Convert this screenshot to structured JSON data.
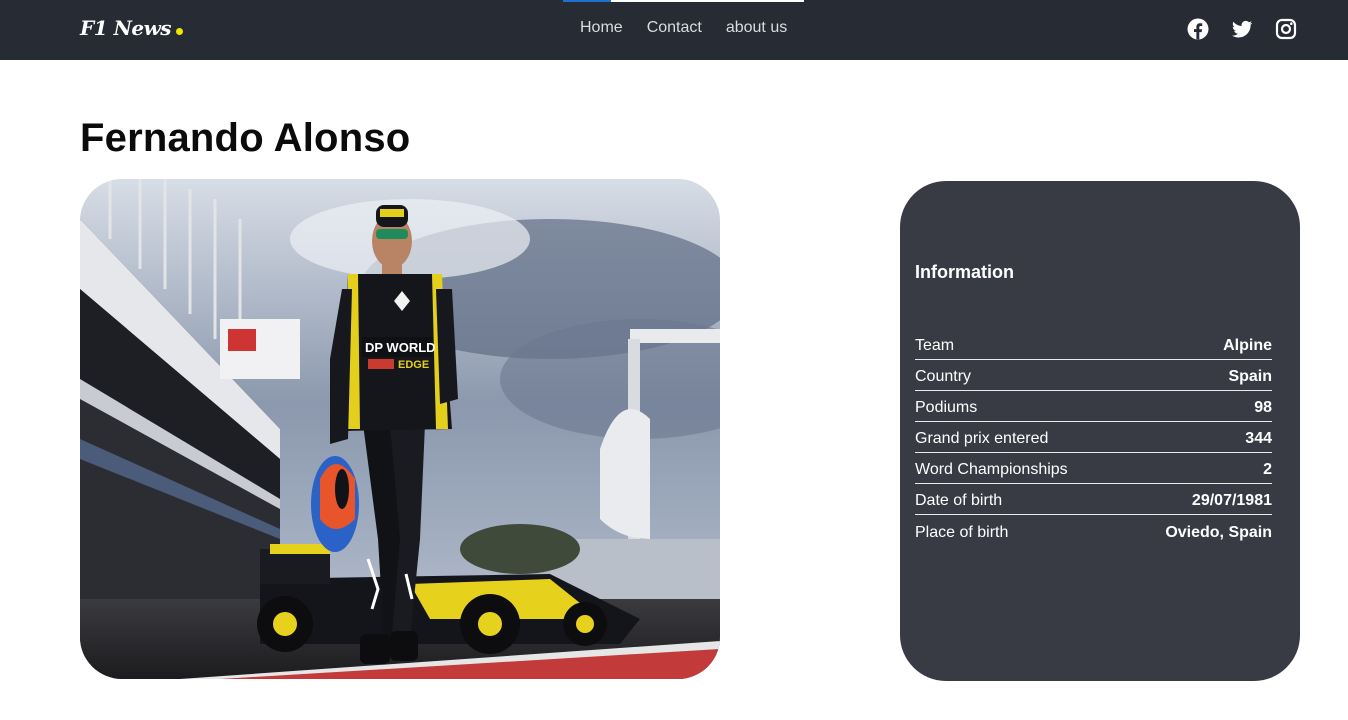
{
  "nav": {
    "logo": "F1 News",
    "scroll_progress": 0.2,
    "links": [
      {
        "label": "Home"
      },
      {
        "label": "Contact"
      },
      {
        "label": "about us"
      }
    ],
    "social": [
      "facebook-icon",
      "twitter-icon",
      "instagram-icon"
    ]
  },
  "colors": {
    "navbar": "#272b34",
    "accent_dot": "#f3e600",
    "card": "#383b44",
    "progress": "#1f6fd0"
  },
  "driver": {
    "name": "Fernando Alonso",
    "photo_icon": "driver-photo"
  },
  "info": {
    "heading": "Information",
    "rows": [
      {
        "label": "Team",
        "value": "Alpine"
      },
      {
        "label": "Country",
        "value": "Spain"
      },
      {
        "label": "Podiums",
        "value": "98"
      },
      {
        "label": "Grand prix entered",
        "value": "344"
      },
      {
        "label": "Word Championships",
        "value": "2"
      },
      {
        "label": "Date of birth",
        "value": "29/07/1981"
      },
      {
        "label": "Place of birth",
        "value": "Oviedo, Spain"
      }
    ]
  }
}
